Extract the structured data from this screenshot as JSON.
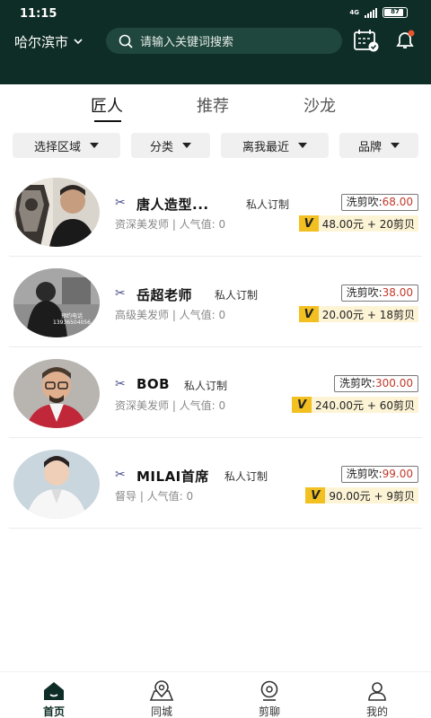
{
  "status": {
    "time": "11:15",
    "network": "4G",
    "battery": "87"
  },
  "header": {
    "city": "哈尔滨市",
    "search_placeholder": "请输入关键词搜索",
    "accent": "#0e2d26",
    "notification_dot_color": "#e8542e"
  },
  "tabs": [
    {
      "label": "匠人",
      "active": true
    },
    {
      "label": "推荐",
      "active": false
    },
    {
      "label": "沙龙",
      "active": false
    }
  ],
  "filters": [
    {
      "label": "选择区域"
    },
    {
      "label": "分类"
    },
    {
      "label": "离我最近"
    },
    {
      "label": "品牌"
    }
  ],
  "stylists": [
    {
      "name": "唐人造型...",
      "tag": "私人订制",
      "subtitle": "资深美发师 | 人气值: 0",
      "price_label": "洗剪吹:",
      "price_value": "68.00",
      "promo": "48.00元 + 20剪贝"
    },
    {
      "name": "岳超老师",
      "tag": "私人订制",
      "subtitle": "高级美发师 | 人气值: 0",
      "price_label": "洗剪吹:",
      "price_value": "38.00",
      "promo": "20.00元 + 18剪贝",
      "avatar_text": "预约电话 13936504056"
    },
    {
      "name": "BOB",
      "tag": "私人订制",
      "subtitle": "资深美发师 | 人气值: 0",
      "price_label": "洗剪吹:",
      "price_value": "300.00",
      "promo": "240.00元 + 60剪贝"
    },
    {
      "name": "MILAI首席",
      "tag": "私人订制",
      "subtitle": "督导 | 人气值: 0",
      "price_label": "洗剪吹:",
      "price_value": "99.00",
      "promo": "90.00元 + 9剪贝"
    }
  ],
  "vip_badge": "V",
  "bottom_nav": [
    {
      "label": "首页",
      "icon": "home-icon",
      "active": true
    },
    {
      "label": "同城",
      "icon": "map-pin-icon",
      "active": false
    },
    {
      "label": "剪聊",
      "icon": "chat-icon",
      "active": false
    },
    {
      "label": "我的",
      "icon": "profile-icon",
      "active": false
    }
  ]
}
